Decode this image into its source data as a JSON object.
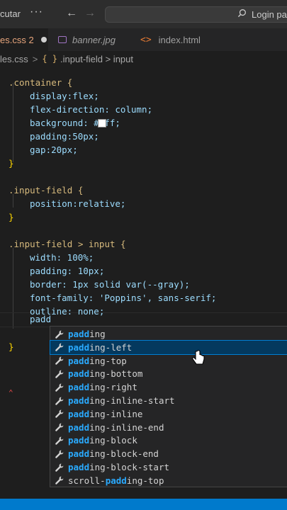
{
  "titlebar": {
    "menu_text": "cutar",
    "more": "···",
    "back": "←",
    "forward": "→",
    "search_text": "Login pag"
  },
  "tabs": [
    {
      "label": "es.css 2",
      "active": true
    },
    {
      "label": "banner.jpg",
      "active": false
    },
    {
      "label": "index.html",
      "active": false
    }
  ],
  "breadcrumb": {
    "file": "les.css",
    "separator": ">",
    "symbol_icon": "{ }",
    "selector": ".input-field > input"
  },
  "code": {
    "lines": [
      ".container {",
      "display:flex;",
      "flex-direction: column;",
      "background: #fff;",
      "padding:50px;",
      "gap:20px;",
      "}",
      ".input-field {",
      "position:relative;",
      "}",
      ".input-field > input {",
      "width: 100%;",
      "padding: 10px;",
      "border: 1px solid var(--gray);",
      "font-family: 'Poppins', sans-serif;",
      "outline: none;",
      "padd",
      "}"
    ]
  },
  "suggestions": {
    "typed": "padd",
    "items": [
      {
        "match": "padd",
        "rest": "ing",
        "prefix": ""
      },
      {
        "match": "padd",
        "rest": "ing-left",
        "prefix": "",
        "selected": true
      },
      {
        "match": "padd",
        "rest": "ing-top",
        "prefix": ""
      },
      {
        "match": "padd",
        "rest": "ing-bottom",
        "prefix": ""
      },
      {
        "match": "padd",
        "rest": "ing-right",
        "prefix": ""
      },
      {
        "match": "padd",
        "rest": "ing-inline-start",
        "prefix": ""
      },
      {
        "match": "padd",
        "rest": "ing-inline",
        "prefix": ""
      },
      {
        "match": "padd",
        "rest": "ing-inline-end",
        "prefix": ""
      },
      {
        "match": "padd",
        "rest": "ing-block",
        "prefix": ""
      },
      {
        "match": "padd",
        "rest": "ing-block-end",
        "prefix": ""
      },
      {
        "match": "padd",
        "rest": "ing-block-start",
        "prefix": ""
      },
      {
        "match": "padd",
        "rest": "ing-top",
        "prefix": "scroll-"
      }
    ]
  },
  "icons": {
    "property": "wrench-icon",
    "pointer": "hand-pointer-icon"
  },
  "colors": {
    "accent": "#007acc",
    "selected_suggestion": "#04395e",
    "match_highlight": "#2aaaff"
  }
}
